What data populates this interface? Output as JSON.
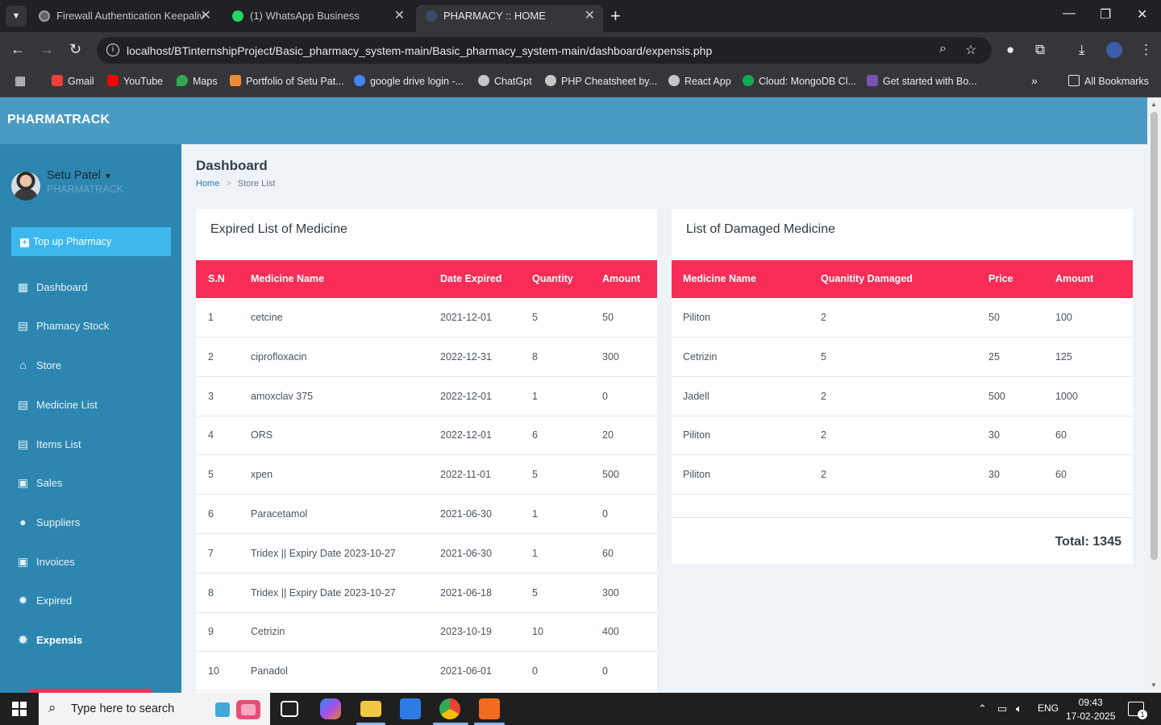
{
  "browser": {
    "tabs": [
      {
        "title": "Firewall Authentication Keepaliv",
        "active": false
      },
      {
        "title": "(1) WhatsApp Business",
        "active": false
      },
      {
        "title": "PHARMACY :: HOME",
        "active": true
      }
    ],
    "url": "localhost/BTinternshipProject/Basic_pharmacy_system-main/Basic_pharmacy_system-main/dashboard/expensis.php",
    "bookmarks": [
      {
        "label": "Gmail",
        "color": "#ea4335"
      },
      {
        "label": "YouTube",
        "color": "#ff0000"
      },
      {
        "label": "Maps",
        "color": "#34a853"
      },
      {
        "label": "Portfolio of Setu Pat...",
        "color": "#f28b30"
      },
      {
        "label": "google drive login -...",
        "color": "#4285f4"
      },
      {
        "label": "ChatGpt",
        "color": "#c4c7c5"
      },
      {
        "label": "PHP Cheatsheet by...",
        "color": "#c4c7c5"
      },
      {
        "label": "React App",
        "color": "#c4c7c5"
      },
      {
        "label": "Cloud: MongoDB Cl...",
        "color": "#13aa52"
      },
      {
        "label": "Get started with Bo...",
        "color": "#7952b3"
      }
    ],
    "all_bookmarks": "All Bookmarks"
  },
  "app": {
    "brand": "PHARMATRACK",
    "user": {
      "name": "Setu Patel",
      "role": "PHARMATRACK"
    },
    "topup_label": "Top up Pharmacy",
    "menu": [
      {
        "label": "Dashboard",
        "icon": "dashboard-icon",
        "active": false
      },
      {
        "label": "Phamacy Stock",
        "icon": "clipboard-icon",
        "active": false
      },
      {
        "label": "Store",
        "icon": "home-icon",
        "active": false
      },
      {
        "label": "Medicine List",
        "icon": "clipboard-icon",
        "active": false
      },
      {
        "label": "Items List",
        "icon": "clipboard-icon",
        "active": false
      },
      {
        "label": "Sales",
        "icon": "money-icon",
        "active": false
      },
      {
        "label": "Suppliers",
        "icon": "user-icon",
        "active": false
      },
      {
        "label": "Invoices",
        "icon": "money-icon",
        "active": false
      },
      {
        "label": "Expired",
        "icon": "gear-badge-icon",
        "active": false
      },
      {
        "label": "Expensis",
        "icon": "alert-badge-icon",
        "active": true
      }
    ],
    "page_title": "Dashboard",
    "breadcrumb": {
      "home": "Home",
      "current": "Store List"
    },
    "expired": {
      "title": "Expired List of Medicine",
      "columns": [
        "S.N",
        "Medicine Name",
        "Date Expired",
        "Quantity",
        "Amount"
      ],
      "rows": [
        [
          "1",
          "cetcine",
          "2021-12-01",
          "5",
          "50"
        ],
        [
          "2",
          "ciprofloxacin",
          "2022-12-31",
          "8",
          "300"
        ],
        [
          "3",
          "amoxclav 375",
          "2022-12-01",
          "1",
          "0"
        ],
        [
          "4",
          "ORS",
          "2022-12-01",
          "6",
          "20"
        ],
        [
          "5",
          "xpen",
          "2022-11-01",
          "5",
          "500"
        ],
        [
          "6",
          "Paracetamol",
          "2021-06-30",
          "1",
          "0"
        ],
        [
          "7",
          "Tridex || Expiry Date 2023-10-27",
          "2021-06-30",
          "1",
          "60"
        ],
        [
          "8",
          "Tridex || Expiry Date 2023-10-27",
          "2021-06-18",
          "5",
          "300"
        ],
        [
          "9",
          "Cetrizin",
          "2023-10-19",
          "10",
          "400"
        ],
        [
          "10",
          "Panadol",
          "2021-06-01",
          "0",
          "0"
        ]
      ]
    },
    "damaged": {
      "title": "List of Damaged Medicine",
      "columns": [
        "Medicine Name",
        "Quanitity Damaged",
        "Price",
        "Amount"
      ],
      "rows": [
        [
          "Piliton",
          "2",
          "50",
          "100"
        ],
        [
          "Cetrizin",
          "5",
          "25",
          "125"
        ],
        [
          "Jadell",
          "2",
          "500",
          "1000"
        ],
        [
          "Piliton",
          "2",
          "30",
          "60"
        ],
        [
          "Piliton",
          "2",
          "30",
          "60"
        ]
      ],
      "total": "Total: 1345"
    },
    "colors": {
      "header": "#4a9bc4",
      "sidebar": "#2c86b0",
      "table_header": "#f72d58",
      "topup": "#3cb8ee"
    }
  },
  "taskbar": {
    "search_placeholder": "Type here to search",
    "lang": "ENG",
    "time": "09:43",
    "date": "17-02-2025",
    "notification_count": "1"
  }
}
